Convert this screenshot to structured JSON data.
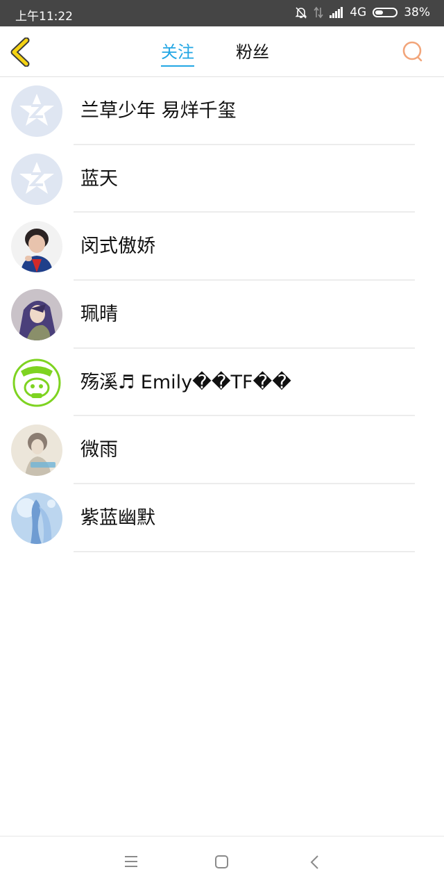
{
  "status_bar": {
    "time": "上午11:22",
    "network": "4G",
    "battery": "38%",
    "battery_level": 0.38
  },
  "header": {
    "tabs": [
      {
        "label": "关注",
        "active": true
      },
      {
        "label": "粉丝",
        "active": false
      }
    ],
    "accent_color": "#22a6e4",
    "back_icon": "chevron-left-icon",
    "search_icon": "search-icon"
  },
  "follow_list": [
    {
      "name": "兰草少年 易烊千玺",
      "avatar": "default-qzone-avatar"
    },
    {
      "name": "蓝天",
      "avatar": "default-qzone-avatar"
    },
    {
      "name": "闵式傲娇",
      "avatar": "photo-avatar-singer"
    },
    {
      "name": "珮晴",
      "avatar": "photo-avatar-anime"
    },
    {
      "name": "殇溪♬ Emily��TF��",
      "avatar": "photo-avatar-green-cartoon"
    },
    {
      "name": "微雨",
      "avatar": "photo-avatar-girl"
    },
    {
      "name": "紫蓝幽默",
      "avatar": "photo-avatar-blue-art"
    }
  ],
  "bottom_nav": {
    "menu_icon": "menu-icon",
    "home_icon": "home-square-icon",
    "back_icon": "back-chevron-icon"
  }
}
